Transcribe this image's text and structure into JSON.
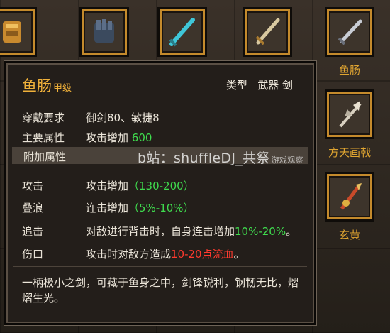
{
  "top_slots": [
    {
      "label": "",
      "icon": "gauntlet-icon"
    },
    {
      "label": "",
      "icon": "gauntlet-icon"
    },
    {
      "label": "",
      "icon": "sword-icon"
    },
    {
      "label": "",
      "icon": "sword-icon"
    },
    {
      "label": "鱼肠",
      "icon": "dagger-icon"
    }
  ],
  "right_slots": [
    {
      "label": "方天画戟",
      "icon": "halberd-icon"
    },
    {
      "label": "玄黄",
      "icon": "spear-icon"
    }
  ],
  "tooltip": {
    "name": "鱼肠",
    "grade": "甲级",
    "type_label": "类型",
    "type_value": "武器 剑",
    "requirement_label": "穿戴要求",
    "requirement_value": "御剑80、敏捷8",
    "main_attr_label": "主要属性",
    "main_attr_text": "攻击增加",
    "main_attr_value": "600",
    "extra_header": "附加属性",
    "attrs": [
      {
        "label": "攻击",
        "text": "攻击增加",
        "value": "（130-200）"
      },
      {
        "label": "叠浪",
        "text": "连击增加",
        "value": "（5%-10%）"
      },
      {
        "label": "追击",
        "text": "对敌进行背击时，自身连击增加",
        "value": "10%-20%",
        "suffix": "。"
      },
      {
        "label": "伤口",
        "text": "攻击时对敌方造成",
        "value": "10-20点流血",
        "suffix": "。"
      }
    ],
    "description": "一柄极小之剑，可藏于鱼身之中，剑锋锐利，钢韧无比，熠熠生光。"
  },
  "watermark": {
    "text": "b站：shuffleDJ_共祭",
    "small": "游戏观察"
  },
  "colors": {
    "accent": "#f0b13a",
    "green": "#3fdc4e",
    "red": "#ff3a2e"
  }
}
